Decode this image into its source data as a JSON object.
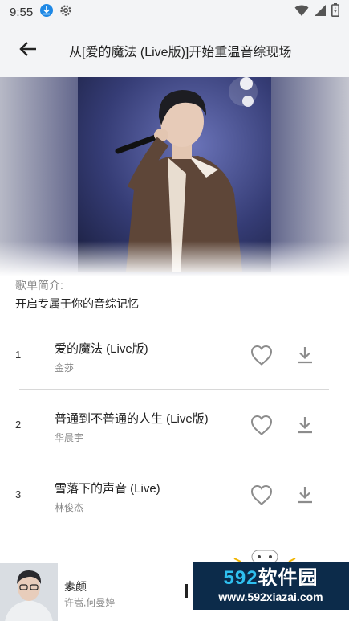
{
  "status_bar": {
    "time": "9:55",
    "icons": [
      "download-icon",
      "gear-icon",
      "wifi-icon",
      "signal-icon",
      "battery-icon"
    ]
  },
  "toolbar": {
    "back_icon": "arrow-left-icon",
    "title": "从[爱的魔法 (Live版)]开始重温音综现场"
  },
  "playlist": {
    "intro_label": "歌单简介:",
    "intro_text": "开启专属于你的音综记忆",
    "tracks": [
      {
        "index": "1",
        "title": "爱的魔法 (Live版)",
        "artist": "金莎"
      },
      {
        "index": "2",
        "title": "普通到不普通的人生 (Live版)",
        "artist": "华晨宇"
      },
      {
        "index": "3",
        "title": "雪落下的声音 (Live)",
        "artist": "林俊杰"
      }
    ]
  },
  "player": {
    "title": "素颜",
    "artist": "许嵩,何曼婷"
  },
  "watermark": {
    "logo_digits": "592",
    "logo_text": "软件园",
    "url": "www.592xiazai.com"
  },
  "colors": {
    "toolbar_bg": "#f3f4f6",
    "hero_blue": "#3c4170",
    "icon_gray": "#8c8c8c",
    "watermark_bg": "#0c2b4a",
    "watermark_accent": "#2fc0f0"
  }
}
